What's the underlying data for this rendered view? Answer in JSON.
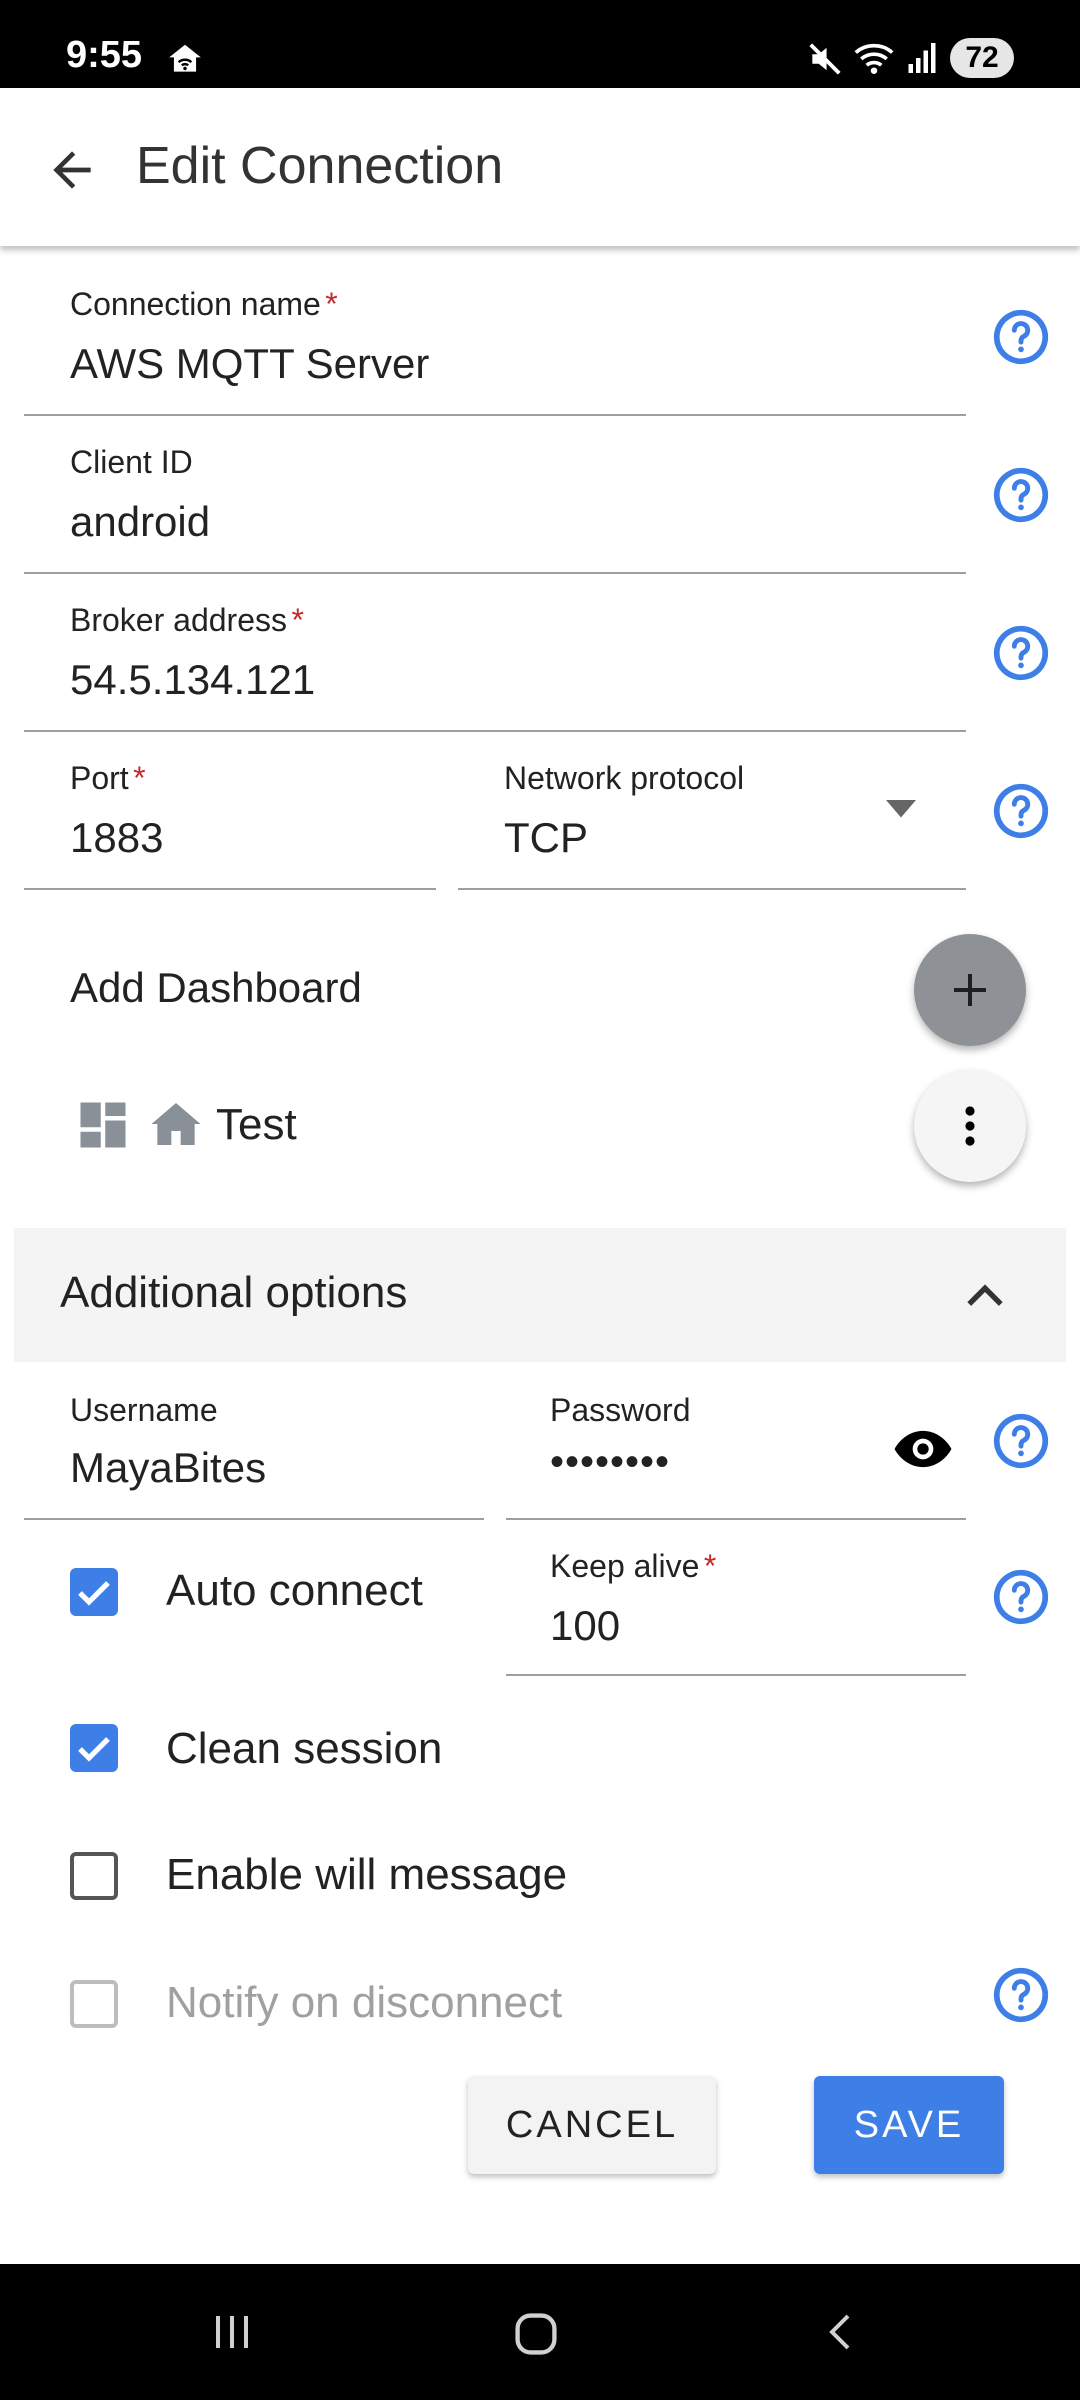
{
  "status_bar": {
    "time": "9:55",
    "battery": "72"
  },
  "app_bar": {
    "title": "Edit Connection"
  },
  "fields": {
    "connection_name": {
      "label": "Connection name",
      "required": "*",
      "value": "AWS MQTT Server"
    },
    "client_id": {
      "label": "Client ID",
      "value": "android"
    },
    "broker_address": {
      "label": "Broker address",
      "required": "*",
      "value": "54.5.134.121"
    },
    "port": {
      "label": "Port",
      "required": "*",
      "value": "1883"
    },
    "network_protocol": {
      "label": "Network protocol",
      "value": "TCP"
    }
  },
  "dashboard": {
    "add_label": "Add Dashboard",
    "item_label": "Test"
  },
  "additional_options": {
    "header": "Additional options",
    "username": {
      "label": "Username",
      "value": "MayaBites"
    },
    "password": {
      "label": "Password",
      "value": "••••••••"
    },
    "keep_alive": {
      "label": "Keep alive",
      "required": "*",
      "value": "100"
    },
    "auto_connect": {
      "label": "Auto connect",
      "checked": true
    },
    "clean_session": {
      "label": "Clean session",
      "checked": true
    },
    "enable_will": {
      "label": "Enable will message",
      "checked": false
    },
    "notify_disconnect": {
      "label": "Notify on disconnect",
      "checked": false,
      "disabled": true
    }
  },
  "actions": {
    "cancel": "CANCEL",
    "save": "SAVE"
  },
  "colors": {
    "accent": "#3d7fe6",
    "required": "#c62828",
    "fab": "#8e9196"
  },
  "icons": [
    "back-arrow-icon",
    "help-icon",
    "dropdown-arrow-icon",
    "plus-icon",
    "more-vert-icon",
    "dashboard-icon",
    "home-icon",
    "chevron-up-icon",
    "eye-icon",
    "check-icon"
  ]
}
